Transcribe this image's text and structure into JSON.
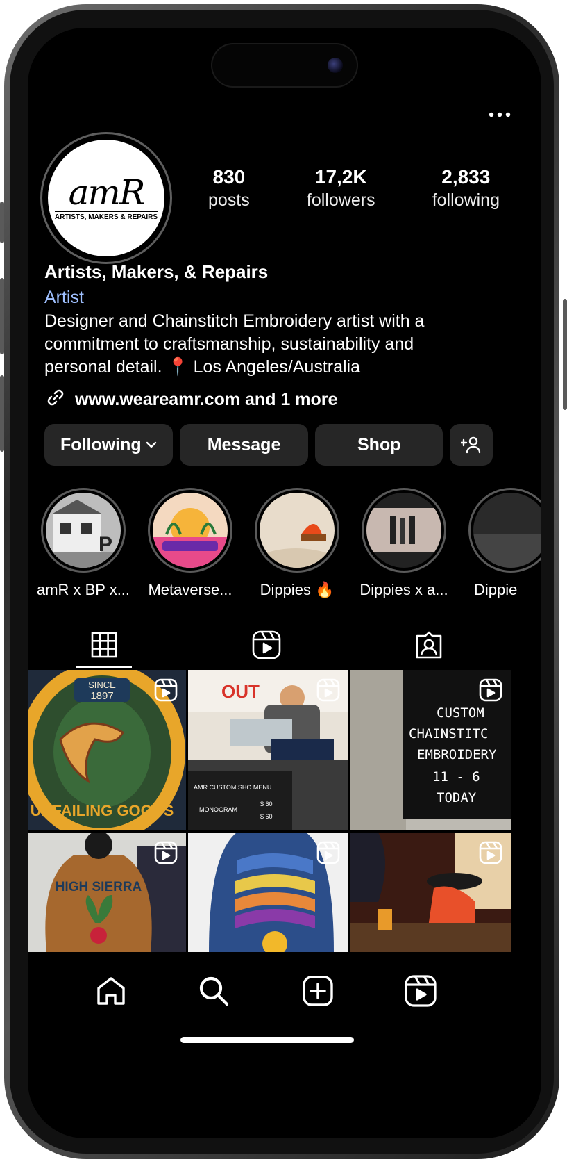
{
  "profile": {
    "logo_text": "amR",
    "logo_subtext": "ARTISTS, MAKERS & REPAIRS",
    "name": "Artists, Makers, & Repairs",
    "category": "Artist",
    "bio_line1": "Designer and Chainstitch Embroidery artist with a",
    "bio_line2": "commitment to craftsmanship, sustainability and",
    "bio_line3": "personal detail. 📍 Los Angeles/Australia",
    "link": "www.weareamr.com and 1 more"
  },
  "stats": [
    {
      "value": "830",
      "label": "posts"
    },
    {
      "value": "17,2K",
      "label": "followers"
    },
    {
      "value": "2,833",
      "label": "following"
    }
  ],
  "actions": {
    "following": "Following",
    "message": "Message",
    "shop": "Shop"
  },
  "highlights": [
    {
      "label": "amR x BP x..."
    },
    {
      "label": "Metaverse..."
    },
    {
      "label": "Dippies 🔥"
    },
    {
      "label": "Dippies x a..."
    },
    {
      "label": "Dippie"
    }
  ],
  "tabs": [
    "grid-icon",
    "reels-icon",
    "tagged-icon"
  ],
  "posts": [
    {
      "text": "SINCE 1897 · UNFAILING GOODS",
      "color": "#2c3a52"
    },
    {
      "text": "AMR CUSTOM SHO MENU · MONOGRAM $60",
      "color": "#7c5a3a"
    },
    {
      "text": "CUSTOM CHAINSTITCH EMBROIDERY 11-6 TODAY",
      "color": "#1a1a1a"
    },
    {
      "text": "HIGH SIERRA",
      "color": "#9a5a26"
    },
    {
      "text": "",
      "color": "#3a5aa8"
    },
    {
      "text": "",
      "color": "#6a2a1a"
    }
  ],
  "menu": {
    "sign_text": "AMR CUSTOM SHO MENU",
    "monogram": "MONOGRAM",
    "price": "$ 60"
  },
  "sign": {
    "line1": "CUSTOM",
    "line2": "CHAINSTITC",
    "line3": "EMBROIDERY",
    "line4": "11 - 6",
    "line5": "TODAY"
  },
  "patch": {
    "since": "SINCE",
    "year": "1897",
    "bottom": "UNFAILING GOODS"
  },
  "jacket_text": "HIGH SIERRA",
  "nav": [
    "home-icon",
    "search-icon",
    "create-icon",
    "reels-icon"
  ]
}
